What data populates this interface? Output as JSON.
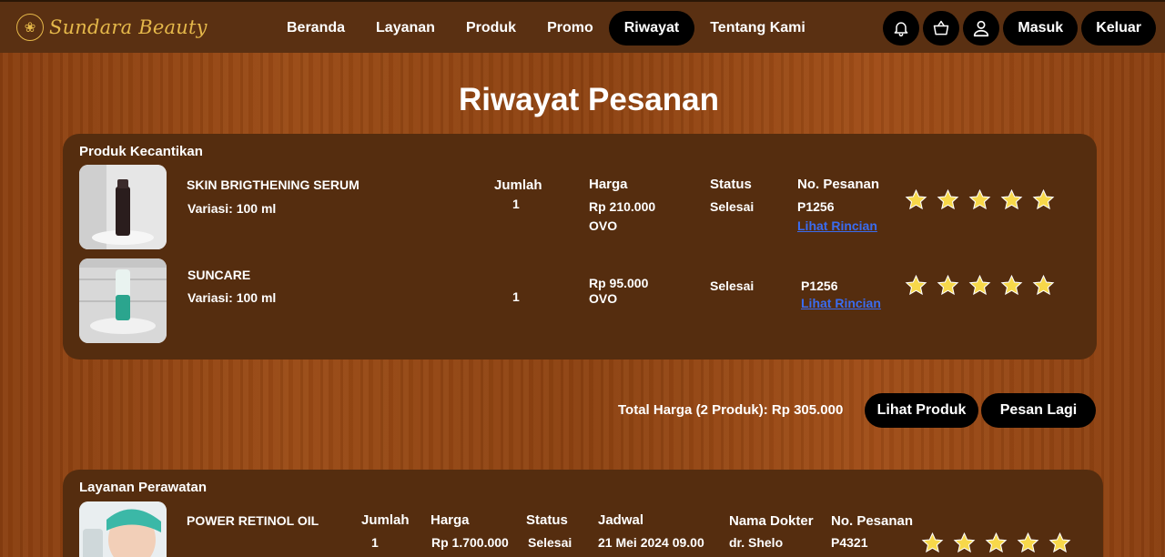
{
  "brand": {
    "name": "Sundara Beauty"
  },
  "nav": {
    "links": [
      "Beranda",
      "Layanan",
      "Produk",
      "Promo",
      "Riwayat",
      "Tentang Kami"
    ],
    "active": "Riwayat",
    "login": "Masuk",
    "logout": "Keluar"
  },
  "page": {
    "title": "Riwayat Pesanan"
  },
  "products": {
    "section_title": "Produk Kecantikan",
    "headers": {
      "qty": "Jumlah",
      "price": "Harga",
      "status": "Status",
      "order_no": "No. Pesanan"
    },
    "items": [
      {
        "name": "SKIN BRIGTHENING SERUM",
        "variant": "Variasi: 100 ml",
        "qty": "1",
        "price": "Rp 210.000",
        "payment": "OVO",
        "status": "Selesai",
        "order_no": "P1256",
        "detail_link": "Lihat Rincian",
        "rating": 5
      },
      {
        "name": "SUNCARE",
        "variant": "Variasi: 100 ml",
        "qty": "1",
        "price": "Rp 95.000",
        "payment": "OVO",
        "status": "Selesai",
        "order_no": "P1256",
        "detail_link": "Lihat Rincian",
        "rating": 5
      }
    ],
    "total": "Total Harga (2 Produk): Rp 305.000",
    "view_button": "Lihat Produk",
    "reorder_button": "Pesan Lagi"
  },
  "services": {
    "section_title": "Layanan Perawatan",
    "headers": {
      "qty": "Jumlah",
      "price": "Harga",
      "status": "Status",
      "schedule": "Jadwal",
      "doctor": "Nama Dokter",
      "order_no": "No. Pesanan"
    },
    "items": [
      {
        "name": "POWER RETINOL OIL",
        "qty": "1",
        "price": "Rp 1.700.000",
        "status": "Selesai",
        "schedule": "21 Mei 2024 09.00",
        "doctor": "dr. Shelo",
        "order_no": "P4321",
        "rating": 5
      }
    ]
  },
  "colors": {
    "nav_bg": "#5a3012",
    "card_bg": "#552d0f",
    "accent_gold": "#e5b84a",
    "link": "#3a6cf0",
    "star": "#f7d84a"
  }
}
